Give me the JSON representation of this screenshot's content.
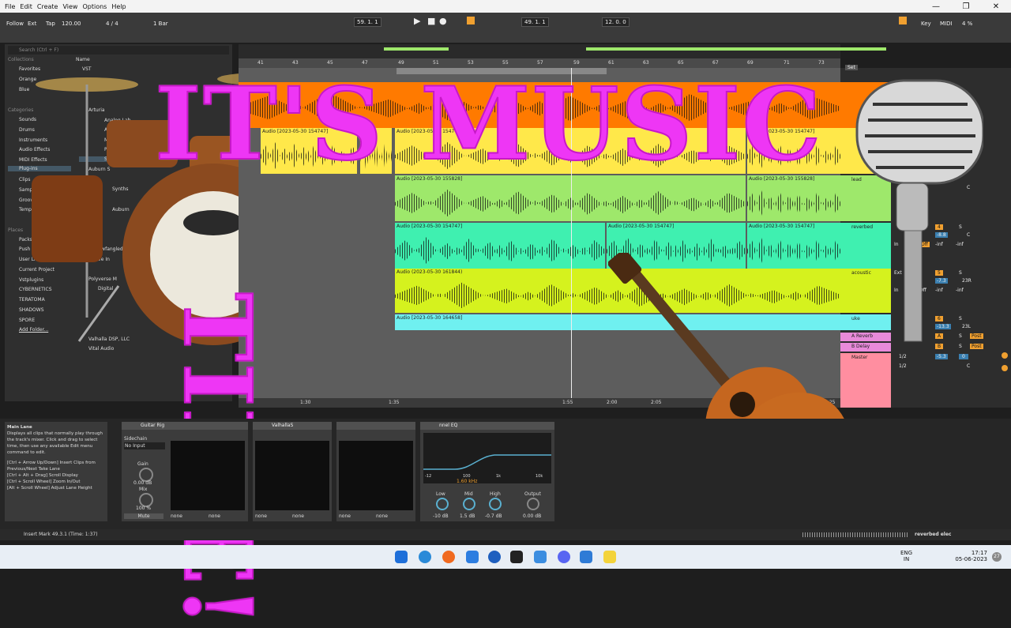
{
  "menu": [
    "File",
    "Edit",
    "Create",
    "View",
    "Options",
    "Help"
  ],
  "toolbar": {
    "follow": "Follow",
    "ext": "Ext",
    "tap": "Tap",
    "tempo": "120.00",
    "signature": "4 / 4",
    "quantize": "1 Bar",
    "position": "59. 1. 1",
    "loop_start": "49. 1. 1",
    "loop_length": "12. 0. 0",
    "key": "Key",
    "midi": "MIDI",
    "cpu": "4 %"
  },
  "browser": {
    "search_placeholder": "Search (Ctrl + F)",
    "collections_label": "Collections",
    "collections": [
      "Favorites",
      "Orange",
      "Blue"
    ],
    "categories_label": "Categories",
    "categories": [
      "Sounds",
      "Drums",
      "Instruments",
      "Audio Effects",
      "MIDI Effects",
      "Plug-ins",
      "Clips",
      "Samples",
      "Grooves",
      "Templates"
    ],
    "places_label": "Places",
    "places": [
      "Packs",
      "Push",
      "User Library",
      "Current Project",
      "Vstplugins",
      "CYBERNETICS",
      "TERATOMA",
      "SHADOWS",
      "SPORE",
      "Add Folder..."
    ],
    "name_header": "Name",
    "items": [
      "VST",
      "Arturia",
      "Analog Lab",
      "Ana",
      "Mi",
      "Pi",
      "St",
      "Auburn S",
      "Synths",
      "Auburn",
      "Newfangled",
      "Native In",
      "Polyverse M",
      "Digital",
      "Valhalla DSP, LLC",
      "Vital Audio"
    ]
  },
  "ruler": [
    "41",
    "43",
    "45",
    "47",
    "49",
    "51",
    "53",
    "55",
    "57",
    "59",
    "61",
    "63",
    "65",
    "67",
    "69",
    "71",
    "73"
  ],
  "time_ruler": [
    "1:30",
    "1:35",
    "1:55",
    "2:00",
    "2:05",
    "2:25"
  ],
  "clips": {
    "audio_2023": "Audio [2023-05-30 154747]",
    "audio_short": "Audio",
    "audio_155828": "Audio [2023-05-30 155828]",
    "audio_154747": "Audio [2023-05-30 154747]",
    "audio_161844": "Audio (2023-05-30 161844)",
    "audio_164658": "Audio [2023-05-30 164658]"
  },
  "tracks": [
    {
      "name": "",
      "color": "#ff7a00"
    },
    {
      "name": "",
      "color": "#ffe84a"
    },
    {
      "name": "lead",
      "color": "#9ee86b"
    },
    {
      "name": "reverbed",
      "color": "#3ff0b0"
    },
    {
      "name": "acoustic",
      "color": "#d5f21e"
    },
    {
      "name": "uke",
      "color": "#6ff0f0"
    }
  ],
  "returns": [
    {
      "name": "A Reverb",
      "color": "#e88ad9"
    },
    {
      "name": "B Delay",
      "color": "#e88ad9"
    },
    {
      "name": "Master",
      "color": "#ff8ea0"
    }
  ],
  "mixer": {
    "set_label": "Set",
    "c_label": "C",
    "inf": "-inf",
    "in": "In",
    "off": "Off",
    "ext": "Ext",
    "post": "Post",
    "half": "1/2",
    "ch4": "4",
    "ch5": "5",
    "ch6": "6",
    "vol4": "-8.8",
    "vol5": "-7.3",
    "vol6": "-13.3",
    "pan5": "23R",
    "pan6": "23L",
    "send_a": "A",
    "send_b": "B",
    "master_vol": "-5.3",
    "master_pan": "0",
    "s_label": "S"
  },
  "info": {
    "title": "Main Lane",
    "body": "Displays all clips that normally play through the track's mixer. Click and drag to select time, then use any available Edit menu command to edit.",
    "help1": "[Ctrl + Arrow Up/Down] Insert Clips from Previous/Next Take Lane",
    "help2": "[Ctrl + Alt + Drag] Scroll Display",
    "help3": "[Ctrl + Scroll Wheel] Zoom In/Out",
    "help4": "[Alt + Scroll Wheel] Adjust Lane Height"
  },
  "devices": {
    "guitar_rig": "Guitar Rig",
    "sidechain": "Sidechain",
    "no_input": "No Input",
    "gain": "Gain",
    "gain_val": "0.00 dB",
    "mix": "Mix",
    "mix_val": "100 %",
    "mute": "Mute",
    "none": "none",
    "valhalla": "ValhallaS",
    "eq_title": "nnel EQ",
    "eq_freq": "1.60 kHz",
    "eq_scale": [
      "-12",
      "100",
      "1k",
      "10k"
    ],
    "eq_knobs": [
      {
        "label": "Low",
        "value": "-10 dB"
      },
      {
        "label": "Mid",
        "value": "1.5 dB"
      },
      {
        "label": "High",
        "value": "-0.7 dB"
      },
      {
        "label": "Output",
        "value": "0.00 dB"
      }
    ]
  },
  "status": {
    "text": "Insert Mark 49.3.1 (Time: 1:37)",
    "track": "reverbed elec"
  },
  "taskbar": {
    "lang": "ENG",
    "region": "IN",
    "time": "17:17",
    "date": "05-06-2023",
    "badge": "27"
  },
  "overlay": {
    "line1": "IT'S MUSIC",
    "line2": "TIME!"
  }
}
